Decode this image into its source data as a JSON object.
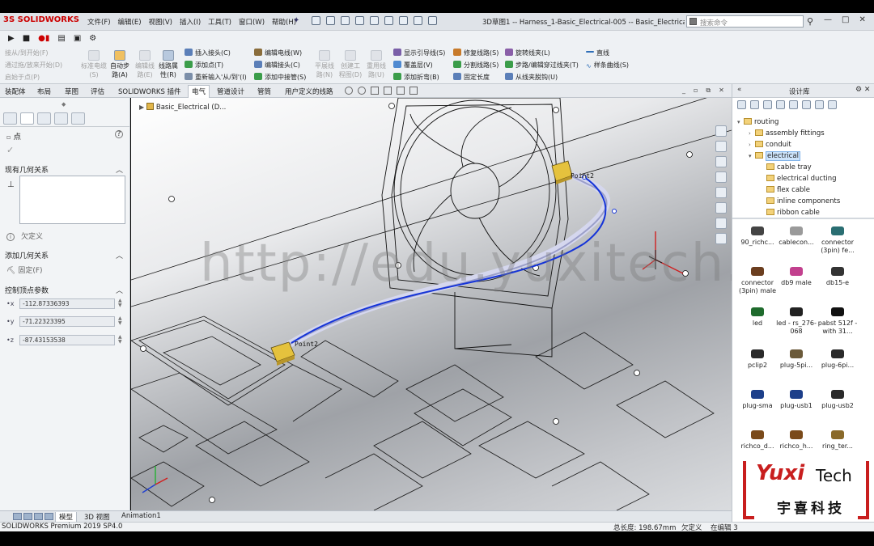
{
  "app": {
    "logo_text": "SOLIDWORKS",
    "logo_mark": "3S",
    "document_title": "3D草图1 -- Harness_1-Basic_Electrical-005 -- Basic_Electrical.SLDA...",
    "search_placeholder": "搜索命令"
  },
  "menu": [
    "文件(F)",
    "编辑(E)",
    "视图(V)",
    "插入(I)",
    "工具(T)",
    "窗口(W)",
    "帮助(H)"
  ],
  "window_buttons": {
    "minimize": "—",
    "restore": "□",
    "close": "✕"
  },
  "command_manager": {
    "disabled_left": [
      "接从/到开始(F)",
      "通过拖/放来开始(D)",
      "启始于点(P)"
    ],
    "big_buttons": [
      {
        "label": "标准电缆(S)",
        "enabled": false
      },
      {
        "label": "自动步路(A)",
        "enabled": true
      },
      {
        "label": "编辑线路(E)",
        "enabled": false
      },
      {
        "label": "线路属性(R)",
        "enabled": true
      }
    ],
    "col1": [
      "插入接头(C)",
      "添加点(T)",
      "重新输入'从/到'(I)"
    ],
    "col2": [
      "编辑电线(W)",
      "编辑接头(C)",
      "添加中接管(S)"
    ],
    "col3_disabled": [
      {
        "label": "平展线路(N)"
      },
      {
        "label": "创建工程图(D)"
      },
      {
        "label": "重用线路(U)"
      }
    ],
    "col4": [
      "显示引导线(S)",
      "覆盖层(V)",
      "添加折弯(B)"
    ],
    "col5": [
      "修复线路(S)",
      "分割线路(S)",
      "固定长度"
    ],
    "col6": [
      "旋转线夹(L)",
      "步路/编辑穿过线夹(T)",
      "从线夹脱钩(U)"
    ],
    "col7": [
      "直线",
      "样条曲线(S)"
    ]
  },
  "tabs": [
    "装配体",
    "布局",
    "草图",
    "评估",
    "SOLIDWORKS 插件",
    "电气",
    "管道设计",
    "管筒",
    "用户定义的线路"
  ],
  "active_tab": "电气",
  "property_manager": {
    "title": "点",
    "existing_relations_header": "现有几何关系",
    "status_hint": "欠定义",
    "add_relations_header": "添加几何关系",
    "fix_label": "固定(F)",
    "control_vertex_header": "控制顶点参数",
    "coords": [
      {
        "axis": "x",
        "value": "-112.87336393"
      },
      {
        "axis": "y",
        "value": "-71.22323395"
      },
      {
        "axis": "z",
        "value": "-87.43153538"
      }
    ]
  },
  "graphics": {
    "doc_tab": "Basic_Electrical  (D...",
    "point_labels": [
      "Point2",
      "Point2"
    ],
    "watermark": "http://edu.yuxitech.com/"
  },
  "design_library": {
    "title": "设计库",
    "tree": [
      {
        "label": "routing",
        "level": 0,
        "expanded": true
      },
      {
        "label": "assembly fittings",
        "level": 1
      },
      {
        "label": "conduit",
        "level": 1
      },
      {
        "label": "electrical",
        "level": 1,
        "selected": true,
        "expanded": true
      },
      {
        "label": "cable tray",
        "level": 2
      },
      {
        "label": "electrical ducting",
        "level": 2
      },
      {
        "label": "flex cable",
        "level": 2
      },
      {
        "label": "inline components",
        "level": 2
      },
      {
        "label": "ribbon cable",
        "level": 2
      }
    ],
    "parts": [
      {
        "label": "90_richc...",
        "color": "#444444"
      },
      {
        "label": "cablecon...",
        "color": "#9a9a9a"
      },
      {
        "label": "connector (3pin) fe...",
        "color": "#2a6e72"
      },
      {
        "label": "connector (3pin) male",
        "color": "#6b3e1f"
      },
      {
        "label": "db9 male",
        "color": "#c2408e"
      },
      {
        "label": "db15-e",
        "color": "#333333"
      },
      {
        "label": "led",
        "color": "#1f6b2d"
      },
      {
        "label": "led - rs_276-068",
        "color": "#222222"
      },
      {
        "label": "pabst 512f - with 31...",
        "color": "#111111"
      },
      {
        "label": "pclip2",
        "color": "#2a2a2a"
      },
      {
        "label": "plug-5pi...",
        "color": "#6b5a3a"
      },
      {
        "label": "plug-6pi...",
        "color": "#2a2a2a"
      },
      {
        "label": "plug-sma",
        "color": "#1d3f8a"
      },
      {
        "label": "plug-usb1",
        "color": "#1d3f8a"
      },
      {
        "label": "plug-usb2",
        "color": "#2a2a2a"
      },
      {
        "label": "richco_d...",
        "color": "#7a4a1a"
      },
      {
        "label": "richco_h...",
        "color": "#7a4a1a"
      },
      {
        "label": "ring_ter...",
        "color": "#8a6a2a"
      }
    ]
  },
  "brand_logo": {
    "text_main": "Yuxi",
    "text_tech": "Tech",
    "cn": "宇喜科技"
  },
  "bottom_tabs": [
    "模型",
    "3D 视图",
    "Animation1"
  ],
  "active_bottom_tab": "模型",
  "status": {
    "product": "SOLIDWORKS Premium 2019 SP4.0",
    "total_length": "总长度: 198.67mm",
    "definition": "欠定义",
    "mode": "在编辑 3"
  }
}
